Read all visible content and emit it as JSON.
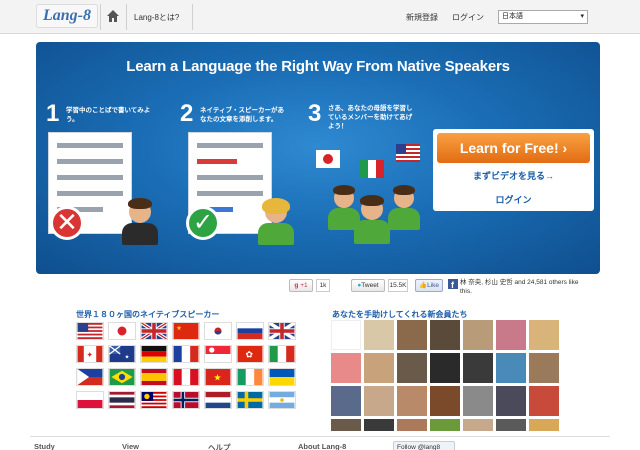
{
  "header": {
    "logo": "Lang-8",
    "what_is": "Lang-8とは?",
    "signup": "新規登録",
    "login": "ログイン",
    "language_selected": "日本語"
  },
  "hero": {
    "title": "Learn a Language the Right Way From Native Speakers",
    "steps": [
      {
        "number": "1",
        "text_line1": "学習中のことばで書いてみよ",
        "text_line2": "う。"
      },
      {
        "number": "2",
        "text_line1": "ネイティブ・スピーカーがあ",
        "text_line2": "なたの文章を添削します。"
      },
      {
        "number": "3",
        "text_line1": "さあ、あなたの母語を学習し",
        "text_line2": "ているメンバーを助けてあげ",
        "text_line3": "よう！"
      }
    ],
    "cta_button": "Learn for Free! ›",
    "video_link": "まずビデオを見る→",
    "login_link": "ログイン"
  },
  "social": {
    "gplus_label": "+1",
    "gplus_count": "1k",
    "tweet_label": "Tweet",
    "tweet_count": "15.5K",
    "like_label": "Like",
    "fb_text": "林 奈央, 杉山 史哲 and 24,581 others like this."
  },
  "sections": {
    "speakers_title": "世界１８０ヶ国のネイティブスピーカー",
    "members_title": "あなたを手助けしてくれる新会員たち"
  },
  "footer": {
    "col1": "Study",
    "col2": "View",
    "col3": "ヘルプ",
    "col4": "About Lang-8",
    "follow": "Follow @lang8"
  },
  "colors": {
    "accent": "#1a5ba8",
    "cta": "#e8781e",
    "hero_blue": "#1a6db5"
  }
}
